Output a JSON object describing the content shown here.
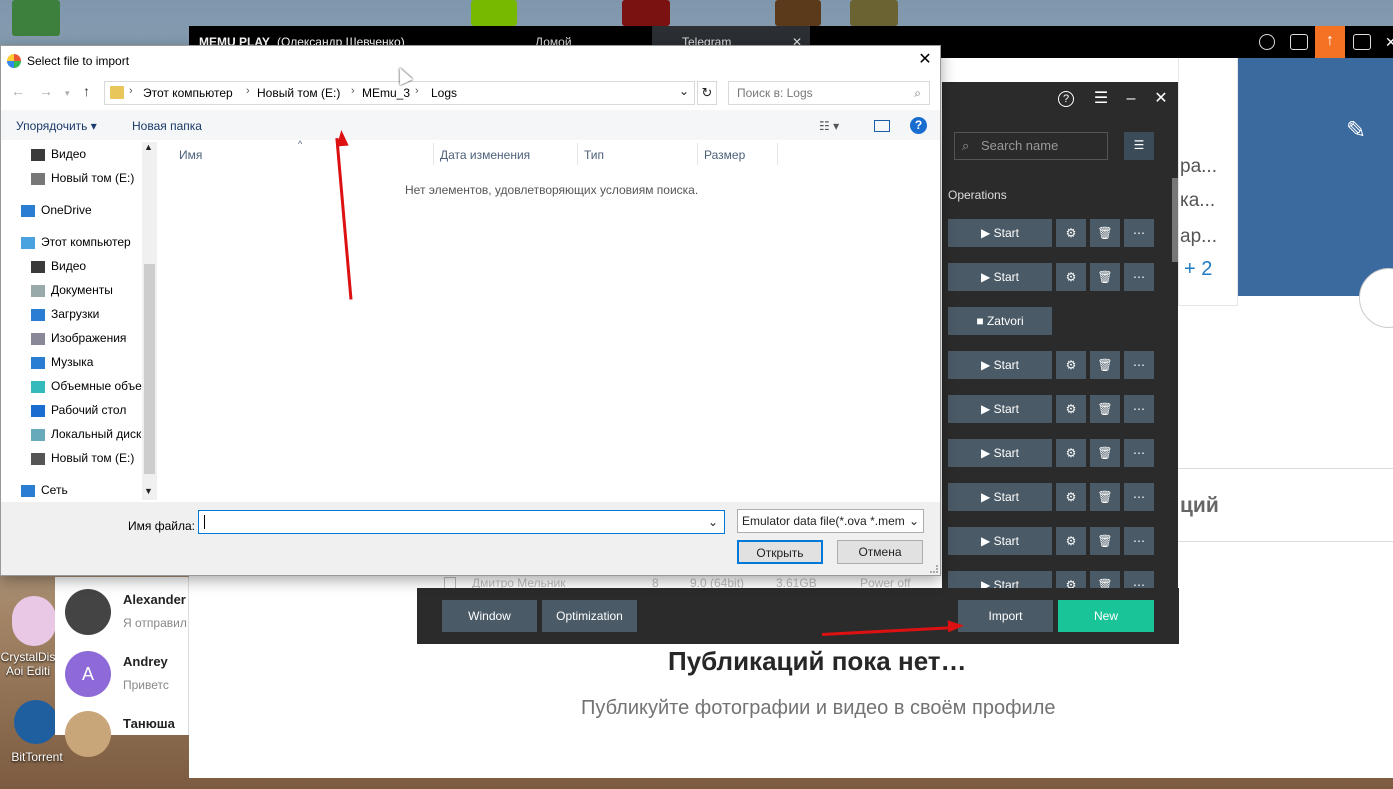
{
  "desktop": {
    "icons": [
      {
        "name": "crystaldisk-icon",
        "label": "CrystalDis Aoi Editi"
      },
      {
        "name": "bittorrent-icon",
        "label": "BitTorrent"
      }
    ]
  },
  "browser": {
    "memu_title": "MEMU PLAY",
    "memu_user": "(Олександр Шевченко)",
    "tab_home": "Домой",
    "tab_telegram": "Telegram",
    "upload_icon": "upload-icon"
  },
  "dialog": {
    "title": "Select file to import",
    "path": [
      "Этот компьютер",
      "Новый том (E:)",
      "MEmu_3",
      "Logs"
    ],
    "search_placeholder": "Поиск в: Logs",
    "organize": "Упорядочить ▾",
    "new_folder": "Новая папка",
    "nav_items": [
      "Видео",
      "Новый том (E:)",
      "OneDrive",
      "Этот компьютер",
      "Видео",
      "Документы",
      "Загрузки",
      "Изображения",
      "Музыка",
      "Объемные объе",
      "Рабочий стол",
      "Локальный диск",
      "Новый том (E:)",
      "Сеть"
    ],
    "columns": [
      "Имя",
      "Дата изменения",
      "Тип",
      "Размер"
    ],
    "empty_message": "Нет элементов, удовлетворяющих условиям поиска.",
    "filename_label": "Имя файла:",
    "filename_value": "",
    "filetype": "Emulator data file(*.ova *.mem",
    "open_label": "Открыть",
    "cancel_label": "Отмена"
  },
  "memu": {
    "search_placeholder": "Search name",
    "operations_label": "Operations",
    "start_label": "Start",
    "stop_label": "Zatvori",
    "peek_row": {
      "name": "Дмитро Мельник",
      "index": "8",
      "version": "9.0 (64bit)",
      "size": "3.61GB",
      "status": "Power off"
    },
    "bottom_buttons": {
      "window": "Window",
      "optimization": "Optimization",
      "import": "Import",
      "new": "New"
    },
    "colors": {
      "accent": "#1ac499",
      "button": "#4a5a66",
      "panel": "#2b2b2b"
    }
  },
  "chats": [
    {
      "name": "Alexander",
      "message": "Я отправил"
    },
    {
      "name": "Andrey",
      "message": "Приветс"
    },
    {
      "name": "Танюша",
      "message": ""
    }
  ],
  "feed": {
    "right_snippets": [
      "ра...",
      "ка...",
      "ар...",
      "+ 2",
      "ций"
    ],
    "empty_title": "Публикаций пока нет…",
    "empty_sub": "Публикуйте фотографии и видео в своём профиле"
  }
}
